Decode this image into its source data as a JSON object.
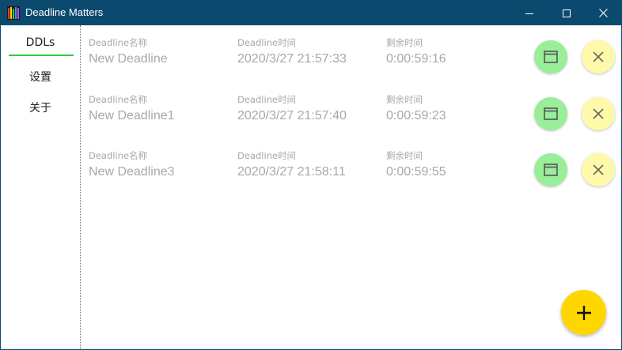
{
  "window": {
    "title": "Deadline Matters"
  },
  "sidebar": {
    "items": [
      {
        "label": "DDLs",
        "selected": true
      },
      {
        "label": "设置",
        "selected": false
      },
      {
        "label": "关于",
        "selected": false
      }
    ]
  },
  "columns": {
    "name_label": "Deadline名称",
    "time_label": "Deadline时间",
    "remaining_label": "剩余时间"
  },
  "deadlines": [
    {
      "name": "New Deadline",
      "time": "2020/3/27 21:57:33",
      "remaining": "0:00:59:16"
    },
    {
      "name": "New Deadline1",
      "time": "2020/3/27 21:57:40",
      "remaining": "0:00:59:23"
    },
    {
      "name": "New Deadline3",
      "time": "2020/3/27 21:58:11",
      "remaining": "0:00:59:55"
    }
  ],
  "colors": {
    "titlebar": "#0b4a6e",
    "accent_underline": "#2ecc40",
    "edit_button": "#99ee99",
    "delete_button": "#fffaaa",
    "add_button": "#ffd700",
    "muted_text": "#a8a8a8"
  },
  "icons": {
    "edit": "window-icon",
    "delete": "close-x-icon",
    "add": "plus-icon"
  }
}
